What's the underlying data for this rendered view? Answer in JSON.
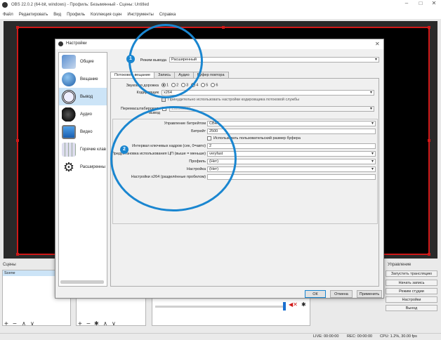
{
  "app": {
    "title": "OBS 22.0.2 (64-bit, windows) - Профиль: Безымянный - Сцены: Untitled",
    "menu": [
      "Файл",
      "Редактировать",
      "Вид",
      "Профиль",
      "Коллекция сцен",
      "Инструменты",
      "Справка"
    ]
  },
  "docks": {
    "scenes_header": "Сцены",
    "scene_item": "Scene",
    "controls_header": "Управление",
    "controls": [
      "Запустить трансляцию",
      "Начать запись",
      "Режим студии",
      "Настройки",
      "Выход"
    ]
  },
  "status": {
    "live": "LIVE: 00:00:00",
    "rec": "REC: 00:00:00",
    "cpu": "CPU: 1.2%, 30.00 fps"
  },
  "dialog": {
    "title": "Настройки",
    "nav": [
      {
        "label": "Общие",
        "icon": "gear-window-icon"
      },
      {
        "label": "Вещание",
        "icon": "globe-icon"
      },
      {
        "label": "Вывод",
        "icon": "broadcast-icon"
      },
      {
        "label": "Аудио",
        "icon": "speaker-icon"
      },
      {
        "label": "Видео",
        "icon": "monitor-icon"
      },
      {
        "label": "Горячие клав",
        "icon": "keyboard-icon"
      },
      {
        "label": "Расширенны",
        "icon": "gears-icon"
      }
    ],
    "output_mode_label": "Режим вывода",
    "output_mode_value": "Расширенный",
    "tabs": [
      "Потоковое вещание",
      "Запись",
      "Аудио",
      "Буфер повтора"
    ],
    "audio_track_label": "Звуковая дорожка",
    "audio_tracks": [
      "1",
      "2",
      "3",
      "4",
      "5",
      "6"
    ],
    "encoder_label": "Кодировщик",
    "encoder_value": "x264",
    "enforce_label": "Принудительно использовать настройки кодировщика потоковой службы",
    "rescale_label": "Перемасштабировать вывод",
    "rescale_value": "1920x1080",
    "rate_control_label": "Управление битрейтом",
    "rate_control_value": "CBR",
    "bitrate_label": "Битрейт",
    "bitrate_value": "2500",
    "custom_buffer_label": "Использовать пользовательский размер буфера",
    "keyframe_label": "Интервал ключевых кадров (сек, 0=авто)",
    "keyframe_value": "2",
    "cpu_preset_label": "Предустановка использования ЦП (выше = меньше)",
    "cpu_preset_value": "veryfast",
    "profile_label": "Профиль",
    "profile_value": "(Нет)",
    "tune_label": "Настройка",
    "tune_value": "(Нет)",
    "x264opts_label": "Настройки x264 (разделённые пробелом)",
    "x264opts_value": "",
    "buttons": {
      "ok": "ОК",
      "cancel": "Отмена",
      "apply": "Применить"
    }
  },
  "annotations": [
    "1",
    "2"
  ],
  "colors": {
    "accent": "#1a86d0",
    "canvas_border": "#d01818",
    "nav_selected": "#cce4f7"
  }
}
